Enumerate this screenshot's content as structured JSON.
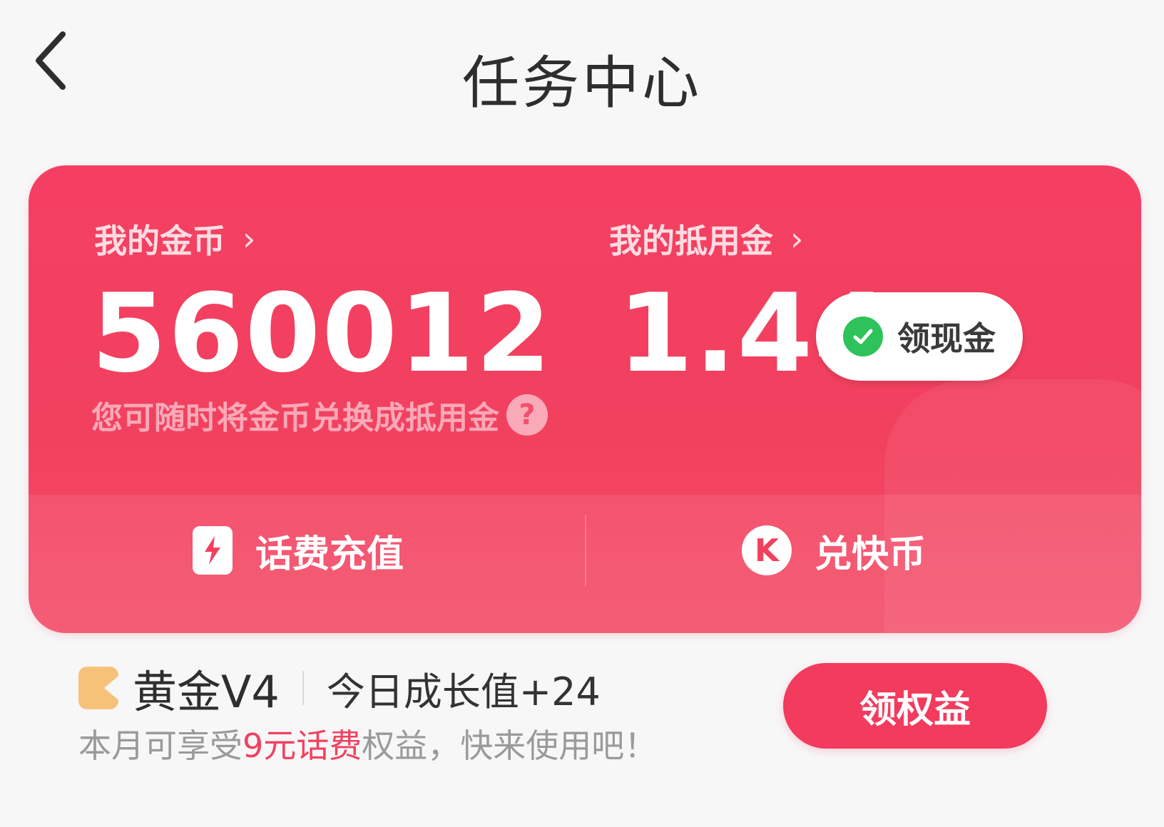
{
  "header": {
    "title": "任务中心"
  },
  "card": {
    "coins": {
      "label": "我的金币",
      "value": "560012"
    },
    "credit": {
      "label": "我的抵用金",
      "value": "1.44"
    },
    "cash_button": {
      "label": "领现金",
      "icon": "wechat-icon"
    },
    "hint": "您可随时将金币兑换成抵用金",
    "actions": {
      "recharge": {
        "label": "话费充值",
        "icon": "bolt-icon"
      },
      "kcoin": {
        "label": "兑快币",
        "icon": "k-icon",
        "icon_letter": "K"
      }
    }
  },
  "level": {
    "name": "黄金V4",
    "growth": "今日成长值+24",
    "benefit_prefix": "本月可享受",
    "benefit_highlight": "9元话费",
    "benefit_suffix": "权益，快来使用吧！",
    "claim_button": "领权益"
  },
  "colors": {
    "accent": "#f2415f",
    "wechat": "#2ec25a",
    "badge_gold": "#f6c27a"
  }
}
